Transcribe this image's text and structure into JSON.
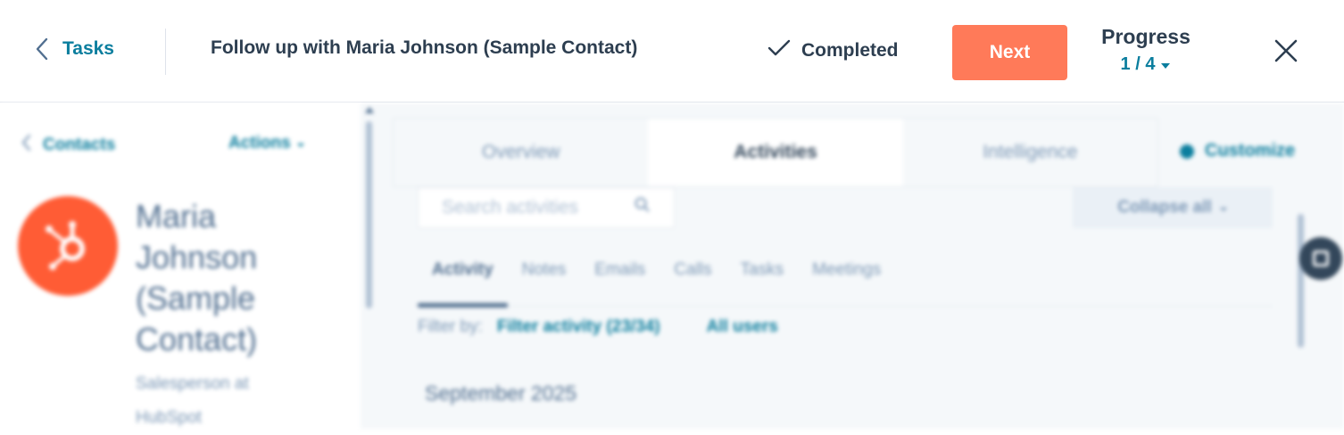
{
  "taskbar": {
    "back_label": "Tasks",
    "task_title": "Follow up with Maria Johnson (Sample Contact)",
    "completed_label": "Completed",
    "next_label": "Next",
    "progress_label": "Progress",
    "progress_value": "1 / 4"
  },
  "contact_panel": {
    "back_label": "Contacts",
    "actions_label": "Actions",
    "name": "Maria Johnson (Sample Contact)",
    "role": "Salesperson at HubSpot"
  },
  "record": {
    "tabs": [
      {
        "label": "Overview",
        "active": false
      },
      {
        "label": "Activities",
        "active": true
      },
      {
        "label": "Intelligence",
        "active": false
      }
    ],
    "customize_label": "Customize",
    "search_placeholder": "Search activities",
    "collapse_label": "Collapse all",
    "activity_tabs": [
      "Activity",
      "Notes",
      "Emails",
      "Calls",
      "Tasks",
      "Meetings"
    ],
    "filter_by_label": "Filter by:",
    "filter_activity": "Filter activity (23/34)",
    "all_users": "All users",
    "month_header": "September 2025"
  },
  "colors": {
    "accent": "#0b7e9e",
    "primary_button": "#ff7a59",
    "avatar": "#ff5c35",
    "text_dark": "#2d3e50"
  },
  "icons": [
    "chevron-left-icon",
    "checkmark-icon",
    "caret-down-icon",
    "close-icon",
    "search-icon",
    "hubspot-sprocket-icon",
    "gear-icon"
  ]
}
